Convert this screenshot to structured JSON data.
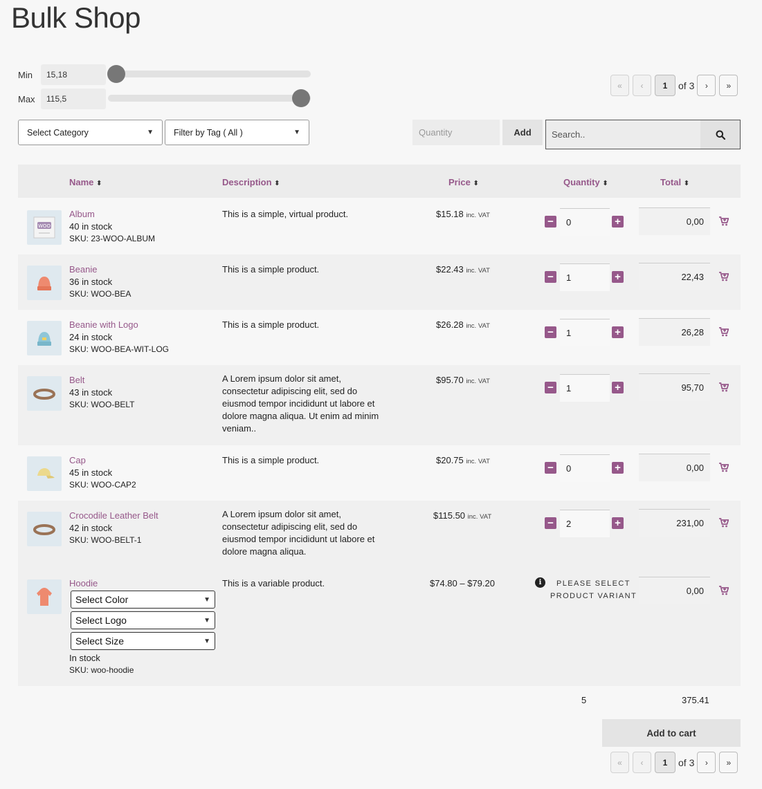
{
  "page": {
    "title": "Bulk Shop"
  },
  "range": {
    "min_label": "Min",
    "min_value": "15,18",
    "max_label": "Max",
    "max_value": "115,5"
  },
  "pager": {
    "first": "«",
    "prev": "‹",
    "current": "1",
    "of_text": "of 3",
    "next": "›",
    "last": "»"
  },
  "filters": {
    "category": "Select Category",
    "tag": "Filter by Tag ( All )"
  },
  "quick_add": {
    "quantity_placeholder": "Quantity",
    "add_label": "Add"
  },
  "search": {
    "placeholder": "Search.."
  },
  "table": {
    "columns": {
      "name": "Name",
      "description": "Description",
      "price": "Price",
      "quantity": "Quantity",
      "total": "Total"
    },
    "sort_glyph": "⬍",
    "rows": [
      {
        "name": "Album",
        "stock": "40 in stock",
        "sku": "SKU: 23-WOO-ALBUM",
        "description": "This is a simple, virtual product.",
        "price": "$15.18",
        "price_suffix": "inc. VAT",
        "qty": "0",
        "total": "0,00"
      },
      {
        "name": "Beanie",
        "stock": "36 in stock",
        "sku": "SKU: WOO-BEA",
        "description": "This is a simple product.",
        "price": "$22.43",
        "price_suffix": "inc. VAT",
        "qty": "1",
        "total": "22,43"
      },
      {
        "name": "Beanie with Logo",
        "stock": "24 in stock",
        "sku": "SKU: WOO-BEA-WIT-LOG",
        "description": "This is a simple product.",
        "price": "$26.28",
        "price_suffix": "inc. VAT",
        "qty": "1",
        "total": "26,28"
      },
      {
        "name": "Belt",
        "stock": "43 in stock",
        "sku": "SKU: WOO-BELT",
        "description": "A Lorem ipsum dolor sit amet, consectetur adipiscing elit, sed do eiusmod tempor incididunt ut labore et dolore magna aliqua. Ut enim ad minim veniam..",
        "price": "$95.70",
        "price_suffix": "inc. VAT",
        "qty": "1",
        "total": "95,70"
      },
      {
        "name": "Cap",
        "stock": "45 in stock",
        "sku": "SKU: WOO-CAP2",
        "description": "This is a simple product.",
        "price": "$20.75",
        "price_suffix": "inc. VAT",
        "qty": "0",
        "total": "0,00"
      },
      {
        "name": "Crocodile Leather Belt",
        "stock": "42 in stock",
        "sku": "SKU: WOO-BELT-1",
        "description": "A Lorem ipsum dolor sit amet, consectetur adipiscing elit, sed do eiusmod tempor incididunt ut labore et dolore magna aliqua.",
        "price": "$115.50",
        "price_suffix": "inc. VAT",
        "qty": "2",
        "total": "231,00"
      },
      {
        "name": "Hoodie",
        "stock": "In stock",
        "sku": "SKU: woo-hoodie",
        "description": "This is a variable product.",
        "price": "$74.80 – $79.20",
        "price_suffix": "",
        "total": "0,00",
        "variants": [
          "Select Color",
          "Select Logo",
          "Select Size"
        ],
        "variant_message_1": "PLEASE SELECT",
        "variant_message_2": "PRODUCT VARIANT"
      }
    ]
  },
  "summary": {
    "quantity": "5",
    "total": "375.41",
    "add_to_cart": "Add to cart"
  },
  "colors": {
    "accent": "#96588a",
    "background": "#f7f7f7"
  }
}
